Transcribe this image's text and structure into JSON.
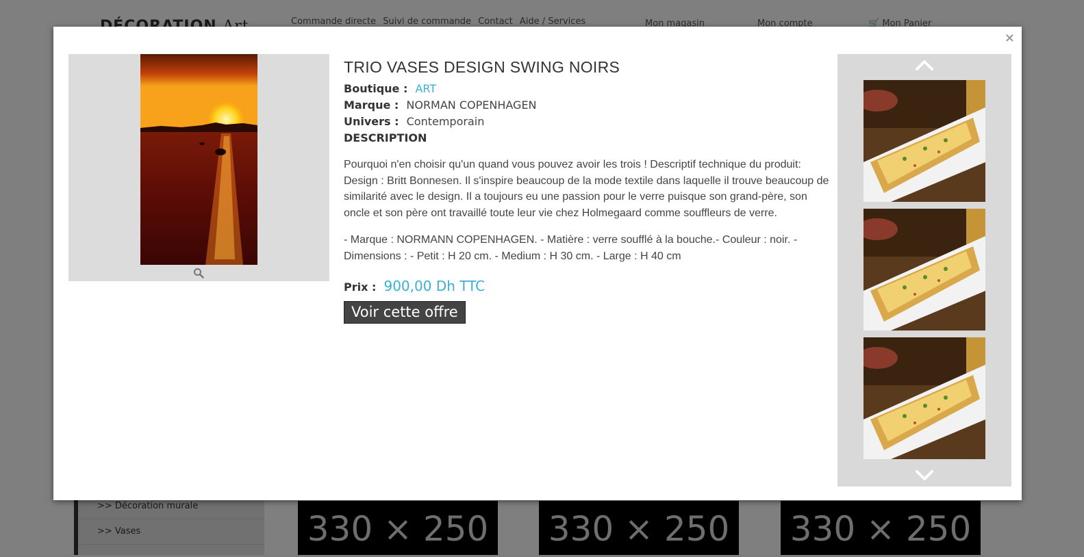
{
  "background": {
    "logo": "DÉCORATION",
    "logo_art": "Art",
    "top_nav": [
      "Commande directe",
      "Suivi de commande",
      "Contact",
      "Aide / Services"
    ],
    "account_links": {
      "store": "Mon magasin",
      "account": "Mon compte",
      "cart": "Mon Panier"
    },
    "sidebar_items": [
      ">>  Décoration murale",
      ">>  Vases"
    ],
    "placeholder_label": "330 × 250"
  },
  "modal": {
    "close": "×",
    "product": {
      "title": "TRIO VASES DESIGN SWING NOIRS",
      "boutique_label": "Boutique :",
      "boutique_value": "ART",
      "marque_label": "Marque :",
      "marque_value": "NORMAN COPENHAGEN",
      "univers_label": "Univers :",
      "univers_value": "Contemporain",
      "description_heading": "DESCRIPTION",
      "description_1": "Pourquoi n'en choisir qu'un quand vous pouvez avoir les trois ! Descriptif technique du produit: Design : Britt Bonnesen. Il s'inspire beaucoup de la mode textile dans laquelle il trouve beaucoup de similarité avec le design. Il a toujours eu une passion pour le verre puisque son grand-père, son oncle et son père ont travaillé toute leur vie chez Holmegaard comme souffleurs de verre.",
      "description_2": "- Marque : NORMANN COPENHAGEN. - Matière : verre soufflé à la bouche.- Couleur : noir. - Dimensions : - Petit : H 20 cm. - Medium : H 30 cm. - Large : H 40 cm",
      "price_label": "Prix :",
      "price_value": "900,00 Dh TTC",
      "cta": "Voir cette offre"
    },
    "icons": {
      "zoom": "magnifier-icon",
      "up": "chevron-up-icon",
      "down": "chevron-down-icon"
    },
    "colors": {
      "accent": "#3bb0d6",
      "button": "#444444"
    }
  }
}
